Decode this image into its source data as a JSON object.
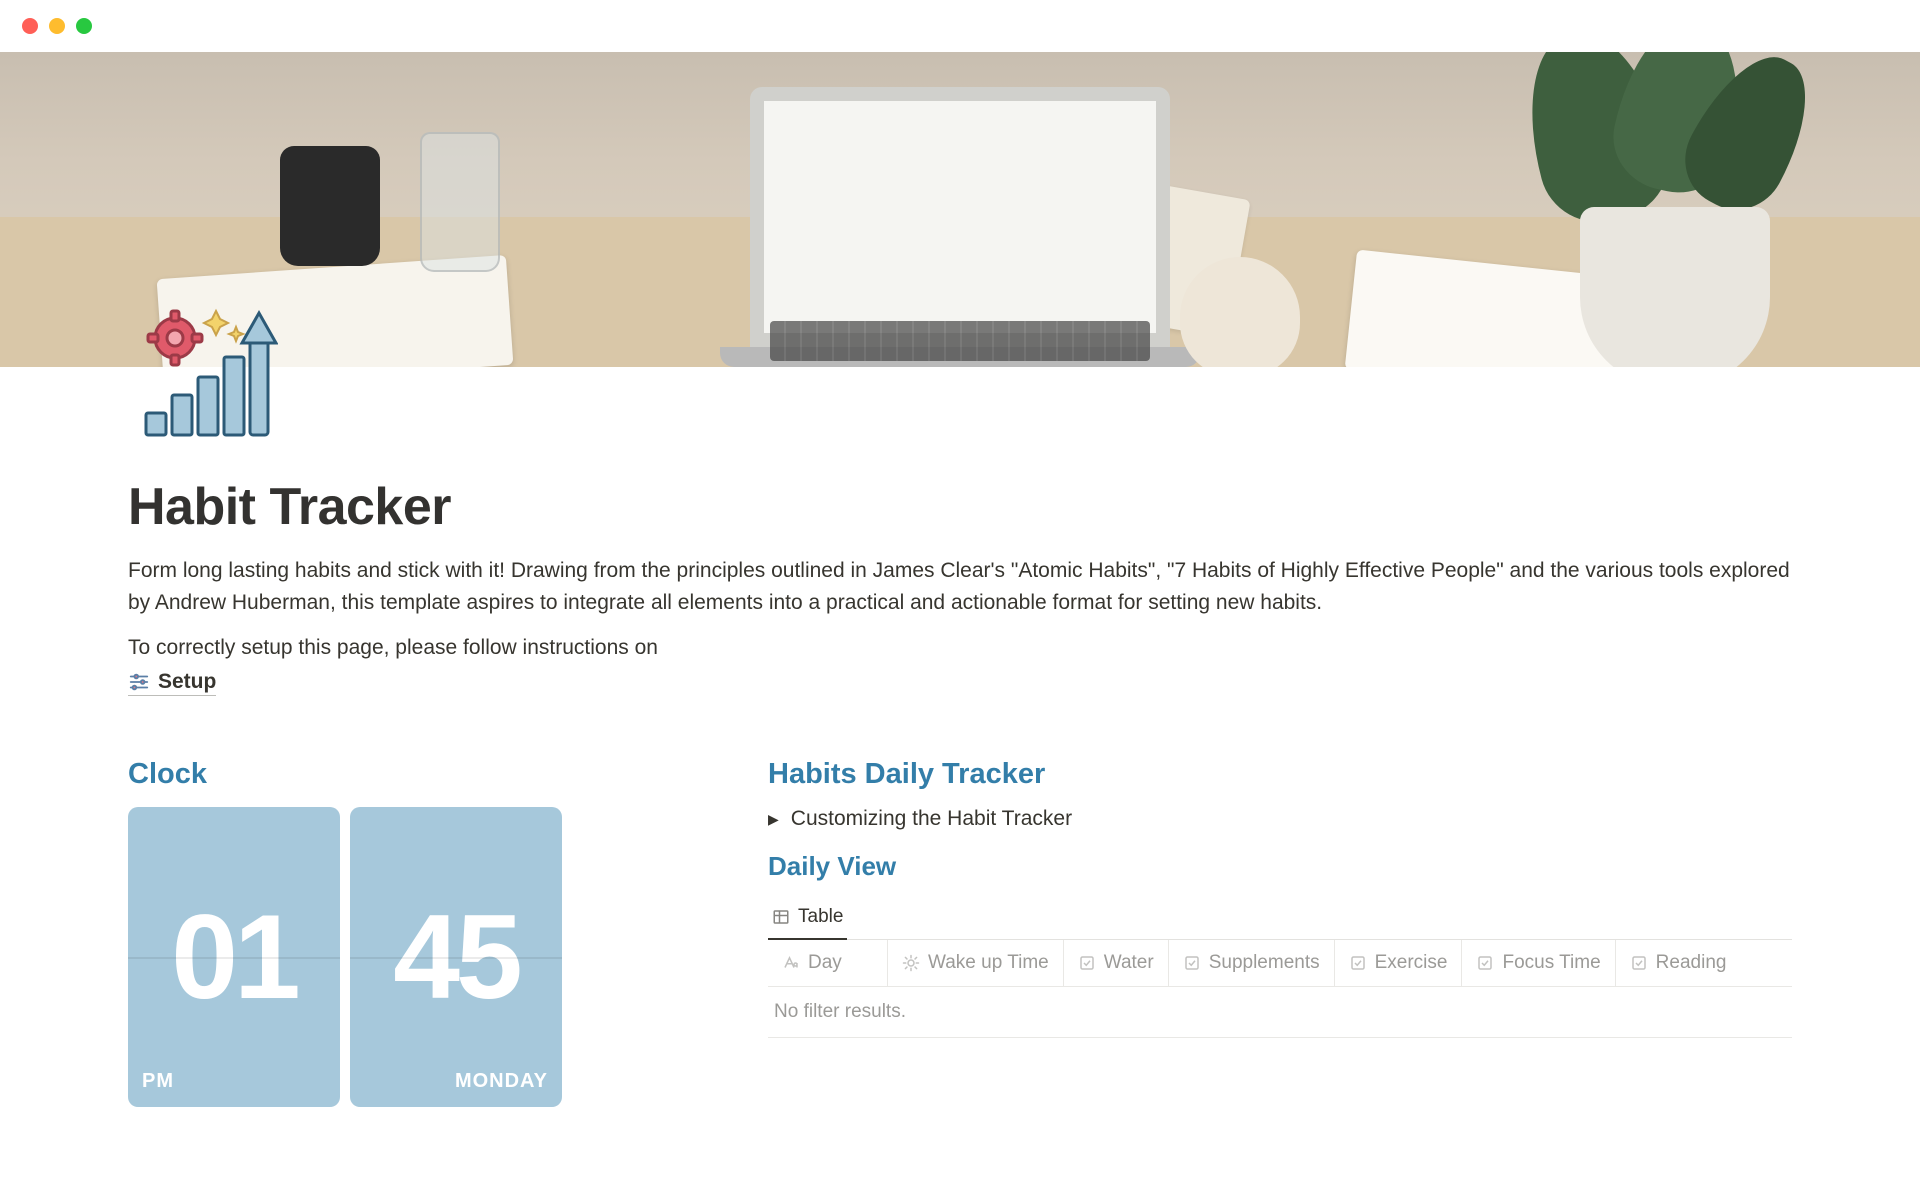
{
  "page": {
    "title": "Habit Tracker",
    "description": "Form long lasting habits and stick with it! Drawing from the principles outlined in James Clear's \"Atomic Habits\", \"7 Habits of Highly Effective People\" and the various tools explored by Andrew Huberman, this template aspires to integrate all elements into a practical and actionable format for setting new habits.",
    "setup_note": "To correctly setup this page, please follow instructions on",
    "setup_link_label": "Setup"
  },
  "clock": {
    "heading": "Clock",
    "hour": "01",
    "minute": "45",
    "ampm": "PM",
    "day": "MONDAY"
  },
  "tracker": {
    "heading": "Habits Daily Tracker",
    "toggle_label": "Customizing the Habit Tracker",
    "daily_view_heading": "Daily View",
    "tab_label": "Table",
    "columns": {
      "day": "Day",
      "wake": "Wake up Time",
      "water": "Water",
      "supp": "Supplements",
      "exercise": "Exercise",
      "focus": "Focus Time",
      "reading": "Reading"
    },
    "empty_text": "No filter results."
  }
}
